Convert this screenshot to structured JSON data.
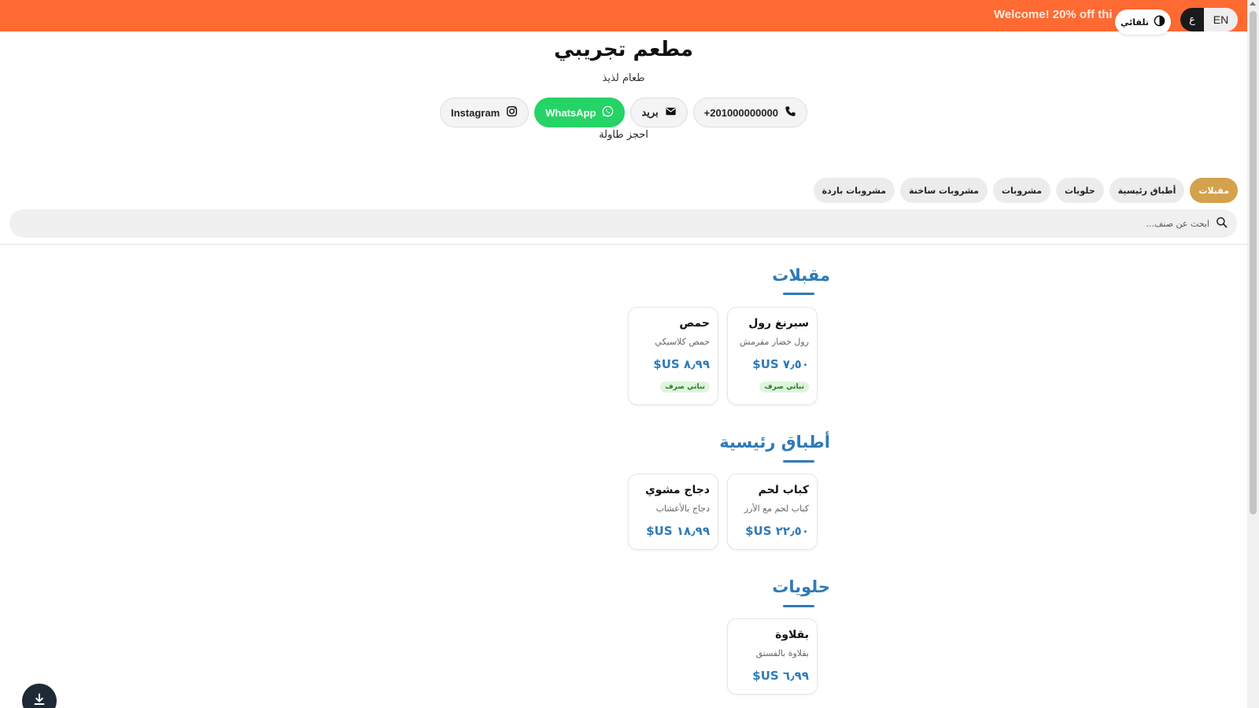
{
  "banner": {
    "text": "Welcome! 20% off thi"
  },
  "controls": {
    "lang_en": "EN",
    "lang_ar": "ع",
    "theme_label": "تلقائي"
  },
  "header": {
    "title": "مطعم تجريبي",
    "subtitle": "طعام لذيذ",
    "reserve": "احجز طاولة"
  },
  "contacts": {
    "phone": "+201000000000",
    "email": "بريد",
    "whatsapp": "WhatsApp",
    "instagram": "Instagram"
  },
  "tabs": [
    "مقبلات",
    "أطباق رئيسية",
    "حلويات",
    "مشروبات",
    "مشروبات ساخنة",
    "مشروبات باردة"
  ],
  "search": {
    "placeholder": "ابحث عن صنف..."
  },
  "sections": [
    {
      "title": "مقبلات",
      "items": [
        {
          "name": "سبرنغ رول",
          "desc": "رول خضار مقرمش",
          "price": "٧٫٥٠ US$",
          "badge": "نباتي صرف"
        },
        {
          "name": "حمص",
          "desc": "حمص كلاسيكي",
          "price": "٨٫٩٩ US$",
          "badge": "نباتي صرف"
        }
      ]
    },
    {
      "title": "أطباق رئيسية",
      "items": [
        {
          "name": "كباب لحم",
          "desc": "كباب لحم مع الأرز",
          "price": "٢٢٫٥٠ US$"
        },
        {
          "name": "دجاج مشوي",
          "desc": "دجاج بالأعشاب",
          "price": "١٨٫٩٩ US$"
        }
      ]
    },
    {
      "title": "حلويات",
      "items": [
        {
          "name": "بقلاوة",
          "desc": "بقلاوة بالفستق",
          "price": "٦٫٩٩ US$"
        }
      ]
    }
  ],
  "colors": {
    "banner": "#ff6a33",
    "accent": "#2e7ab8",
    "active_tab": "#d4a24c",
    "whatsapp": "#25d366"
  }
}
